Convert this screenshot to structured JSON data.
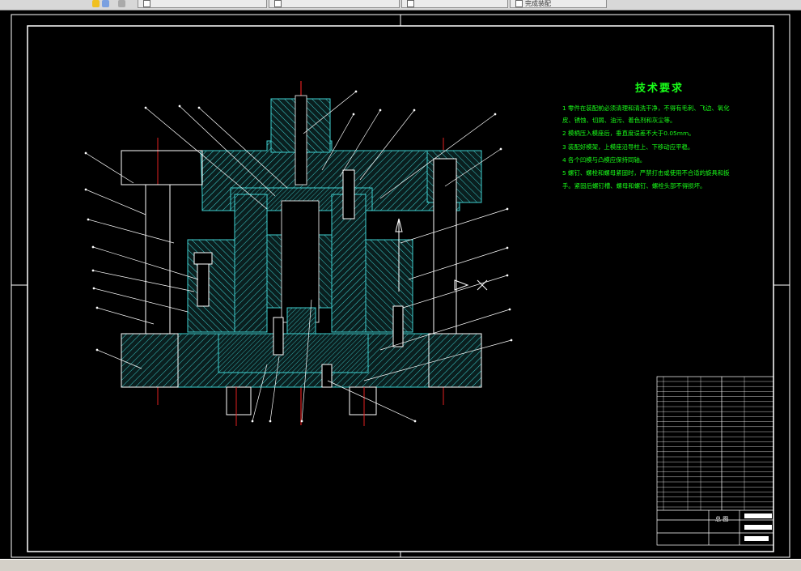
{
  "toolbar": {
    "tabs": [
      {
        "label": ""
      },
      {
        "label": ""
      },
      {
        "label": ""
      },
      {
        "label": "完成装配"
      }
    ]
  },
  "tech_requirements": {
    "title": "技术要求",
    "lines": [
      "1 零件在装配前必须清理和清洗干净，不得有毛刺、飞边、氧化",
      "皮、锈蚀、切屑、油污、着色剂和灰尘等。",
      "2 模柄压入模座后，垂直度误差不大于0.05mm。",
      "3 装配好模架，上模座沿导柱上、下移动应平稳。",
      "4 各个凹模与凸模应保持同轴。",
      "5 螺钉、螺栓和螺母紧固时，严禁打击或使用不合适的旋具和扳",
      "手。紧固后螺钉槽、螺母和螺钉、螺栓头部不得损坏。"
    ]
  },
  "title_block": {
    "material": "",
    "scale": "",
    "name_label": "总 图",
    "school": "",
    "drawing_name": "",
    "drawing_no": ""
  },
  "colors": {
    "background": "#000000",
    "frame": "#ffffff",
    "hatch": "#3fcfcf",
    "centerline": "#e02020",
    "text": "#19ff19"
  }
}
